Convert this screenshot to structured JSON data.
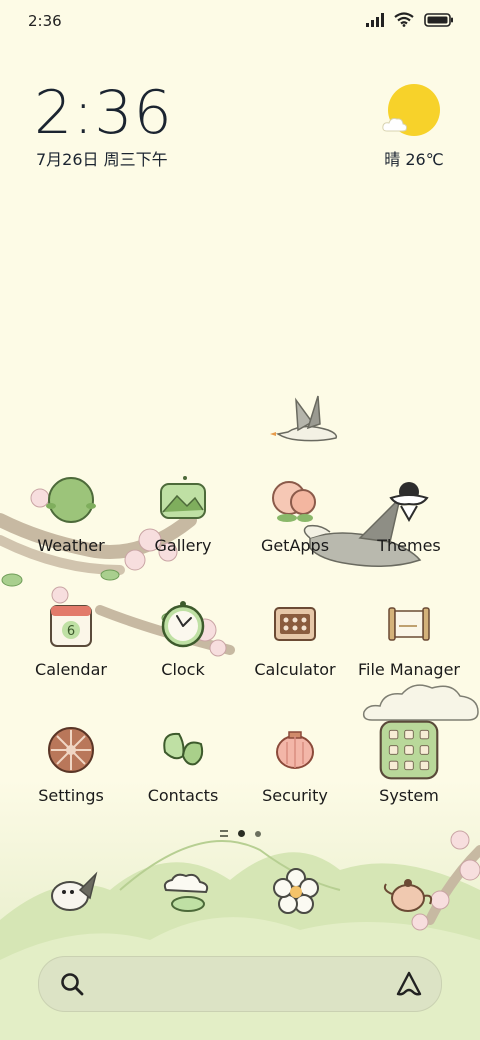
{
  "status_bar": {
    "time": "2:36"
  },
  "clock_widget": {
    "time": "2:36",
    "date": "7月26日 周三下午"
  },
  "weather_widget": {
    "text": "晴 26℃"
  },
  "apps": [
    {
      "label": "Weather",
      "icon": "weather-icon"
    },
    {
      "label": "Gallery",
      "icon": "gallery-icon"
    },
    {
      "label": "GetApps",
      "icon": "getapps-icon"
    },
    {
      "label": "Themes",
      "icon": "themes-icon"
    },
    {
      "label": "Calendar",
      "icon": "calendar-icon"
    },
    {
      "label": "Clock",
      "icon": "clock-icon"
    },
    {
      "label": "Calculator",
      "icon": "calculator-icon"
    },
    {
      "label": "File Manager",
      "icon": "file-manager-icon"
    },
    {
      "label": "Settings",
      "icon": "settings-icon"
    },
    {
      "label": "Contacts",
      "icon": "contacts-icon"
    },
    {
      "label": "Security",
      "icon": "security-icon"
    },
    {
      "label": "System",
      "icon": "system-folder-icon"
    }
  ],
  "calendar_day": "6",
  "dock": [
    "phone-bird-icon",
    "messages-cloud-icon",
    "browser-flower-icon",
    "camera-teapot-icon"
  ],
  "pages": {
    "count": 2,
    "current": 1
  },
  "colors": {
    "background": "#fdfbe6",
    "accent_green": "#9cc47a",
    "sun_yellow": "#f7d22a"
  }
}
